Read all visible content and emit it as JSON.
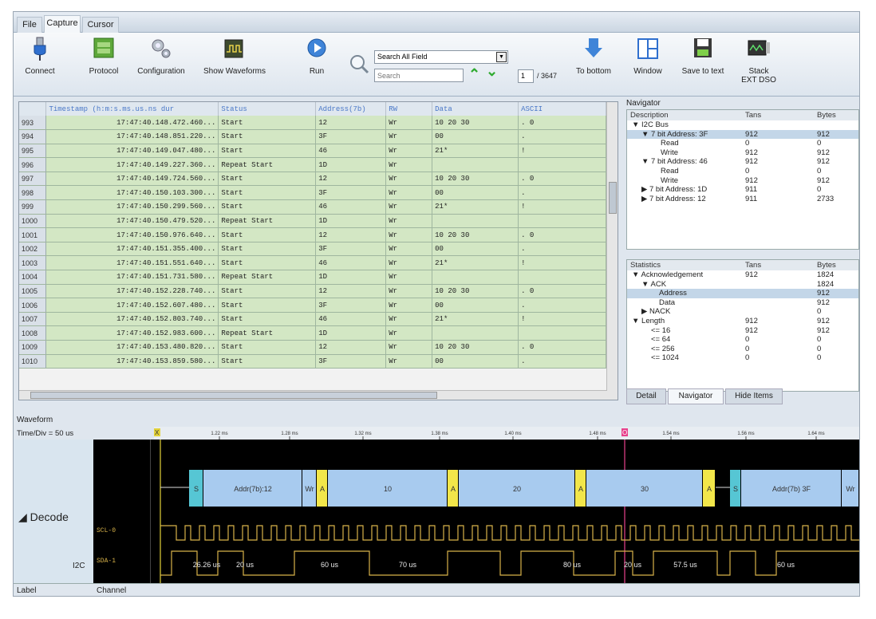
{
  "tabs": [
    "File",
    "Capture",
    "Cursor"
  ],
  "toolbar": {
    "connect": "Connect",
    "protocol": "Protocol",
    "configuration": "Configuration",
    "show_waveforms": "Show Waveforms",
    "run": "Run",
    "search_scope": "Search All Field",
    "search_placeholder": "Search",
    "page_current": "1",
    "page_total": "/ 3647",
    "to_bottom": "To bottom",
    "window": "Window",
    "save_to_text": "Save to text",
    "stack_ext_dso_1": "Stack",
    "stack_ext_dso_2": "EXT DSO"
  },
  "grid": {
    "columns": [
      "Timestamp (h:m:s.ms.us.ns dur",
      "Status",
      "Address(7b)",
      "RW",
      "Data",
      "ASCII"
    ],
    "rows": [
      [
        "993",
        "17:47:40.148.472.460...",
        "Start",
        "12",
        "Wr",
        "10 20 30",
        ". 0"
      ],
      [
        "994",
        "17:47:40.148.851.220...",
        "Start",
        "3F",
        "Wr",
        "00",
        "."
      ],
      [
        "995",
        "17:47:40.149.047.480...",
        "Start",
        "46",
        "Wr",
        "21*",
        "!"
      ],
      [
        "996",
        "17:47:40.149.227.360...",
        "Repeat Start",
        "1D",
        "Wr",
        "",
        ""
      ],
      [
        "997",
        "17:47:40.149.724.560...",
        "Start",
        "12",
        "Wr",
        "10 20 30",
        ". 0"
      ],
      [
        "998",
        "17:47:40.150.103.300...",
        "Start",
        "3F",
        "Wr",
        "00",
        "."
      ],
      [
        "999",
        "17:47:40.150.299.560...",
        "Start",
        "46",
        "Wr",
        "21*",
        "!"
      ],
      [
        "1000",
        "17:47:40.150.479.520...",
        "Repeat Start",
        "1D",
        "Wr",
        "",
        ""
      ],
      [
        "1001",
        "17:47:40.150.976.640...",
        "Start",
        "12",
        "Wr",
        "10 20 30",
        ". 0"
      ],
      [
        "1002",
        "17:47:40.151.355.400...",
        "Start",
        "3F",
        "Wr",
        "00",
        "."
      ],
      [
        "1003",
        "17:47:40.151.551.640...",
        "Start",
        "46",
        "Wr",
        "21*",
        "!"
      ],
      [
        "1004",
        "17:47:40.151.731.580...",
        "Repeat Start",
        "1D",
        "Wr",
        "",
        ""
      ],
      [
        "1005",
        "17:47:40.152.228.740...",
        "Start",
        "12",
        "Wr",
        "10 20 30",
        ". 0"
      ],
      [
        "1006",
        "17:47:40.152.607.480...",
        "Start",
        "3F",
        "Wr",
        "00",
        "."
      ],
      [
        "1007",
        "17:47:40.152.803.740...",
        "Start",
        "46",
        "Wr",
        "21*",
        "!"
      ],
      [
        "1008",
        "17:47:40.152.983.600...",
        "Repeat Start",
        "1D",
        "Wr",
        "",
        ""
      ],
      [
        "1009",
        "17:47:40.153.480.820...",
        "Start",
        "12",
        "Wr",
        "10 20 30",
        ". 0"
      ],
      [
        "1010",
        "17:47:40.153.859.580...",
        "Start",
        "3F",
        "Wr",
        "00",
        "."
      ]
    ]
  },
  "navigator": {
    "title": "Navigator",
    "headers": [
      "Description",
      "Tans",
      "Bytes"
    ],
    "rows": [
      {
        "label": "▼ I2C Bus",
        "tans": "",
        "bytes": ""
      },
      {
        "label": "▼ 7 bit Address: 3F",
        "tans": "912",
        "bytes": "912"
      },
      {
        "label": "Read",
        "tans": "0",
        "bytes": "0"
      },
      {
        "label": "Write",
        "tans": "912",
        "bytes": "912"
      },
      {
        "label": "▼ 7 bit Address: 46",
        "tans": "912",
        "bytes": "912"
      },
      {
        "label": "Read",
        "tans": "0",
        "bytes": "0"
      },
      {
        "label": "Write",
        "tans": "912",
        "bytes": "912"
      },
      {
        "label": "▶ 7 bit Address: 1D",
        "tans": "911",
        "bytes": "0"
      },
      {
        "label": "▶ 7 bit Address: 12",
        "tans": "911",
        "bytes": "2733"
      }
    ]
  },
  "statistics": {
    "headers": [
      "Statistics",
      "Tans",
      "Bytes"
    ],
    "rows": [
      {
        "label": "▼ Acknowledgement",
        "tans": "912",
        "bytes": "1824"
      },
      {
        "label": "▼ ACK",
        "tans": "",
        "bytes": "1824"
      },
      {
        "label": "Address",
        "tans": "",
        "bytes": "912"
      },
      {
        "label": "Data",
        "tans": "",
        "bytes": "912"
      },
      {
        "label": "▶ NACK",
        "tans": "",
        "bytes": "0"
      },
      {
        "label": "▼ Length",
        "tans": "912",
        "bytes": "912"
      },
      {
        "label": "<= 16",
        "tans": "912",
        "bytes": "912"
      },
      {
        "label": "<= 64",
        "tans": "0",
        "bytes": "0"
      },
      {
        "label": "<= 256",
        "tans": "0",
        "bytes": "0"
      },
      {
        "label": "<= 1024",
        "tans": "0",
        "bytes": "0"
      }
    ]
  },
  "panel_tabs": [
    "Detail",
    "Navigator",
    "Hide Items"
  ],
  "waveform": {
    "title": "Waveform",
    "time_div": "Time/Div = 50 us",
    "decode_label": "Decode",
    "bus_label": "I2C",
    "scl_label": "SCL-0",
    "sda_label": "SDA-1",
    "ticks": [
      "1.22 ms",
      "1.28 ms",
      "1.32 ms",
      "1.38 ms",
      "1.40 ms",
      "1.48 ms",
      "1.54 ms",
      "1.56 ms",
      "1.64 ms"
    ],
    "marker1": "X",
    "marker2": "O",
    "decode_segments": [
      "S",
      "Addr(7b):12",
      "Wr",
      "A",
      "10",
      "A",
      "20",
      "A",
      "30",
      "A",
      "S",
      "Addr(7b) 3F",
      "Wr"
    ],
    "durations": [
      "26.26 us",
      "20 us",
      "60 us",
      "70 us",
      "80 us",
      "20 us",
      "57.5 us",
      "60 us"
    ]
  },
  "footer": {
    "label": "Label",
    "channel": "Channel"
  },
  "colors": {
    "grid_row": "#d3e7c4",
    "decode_blue": "#a8cbef",
    "ack_yellow": "#f2e64a",
    "start_cyan": "#56c6d4",
    "signal": "#d8b24a"
  }
}
